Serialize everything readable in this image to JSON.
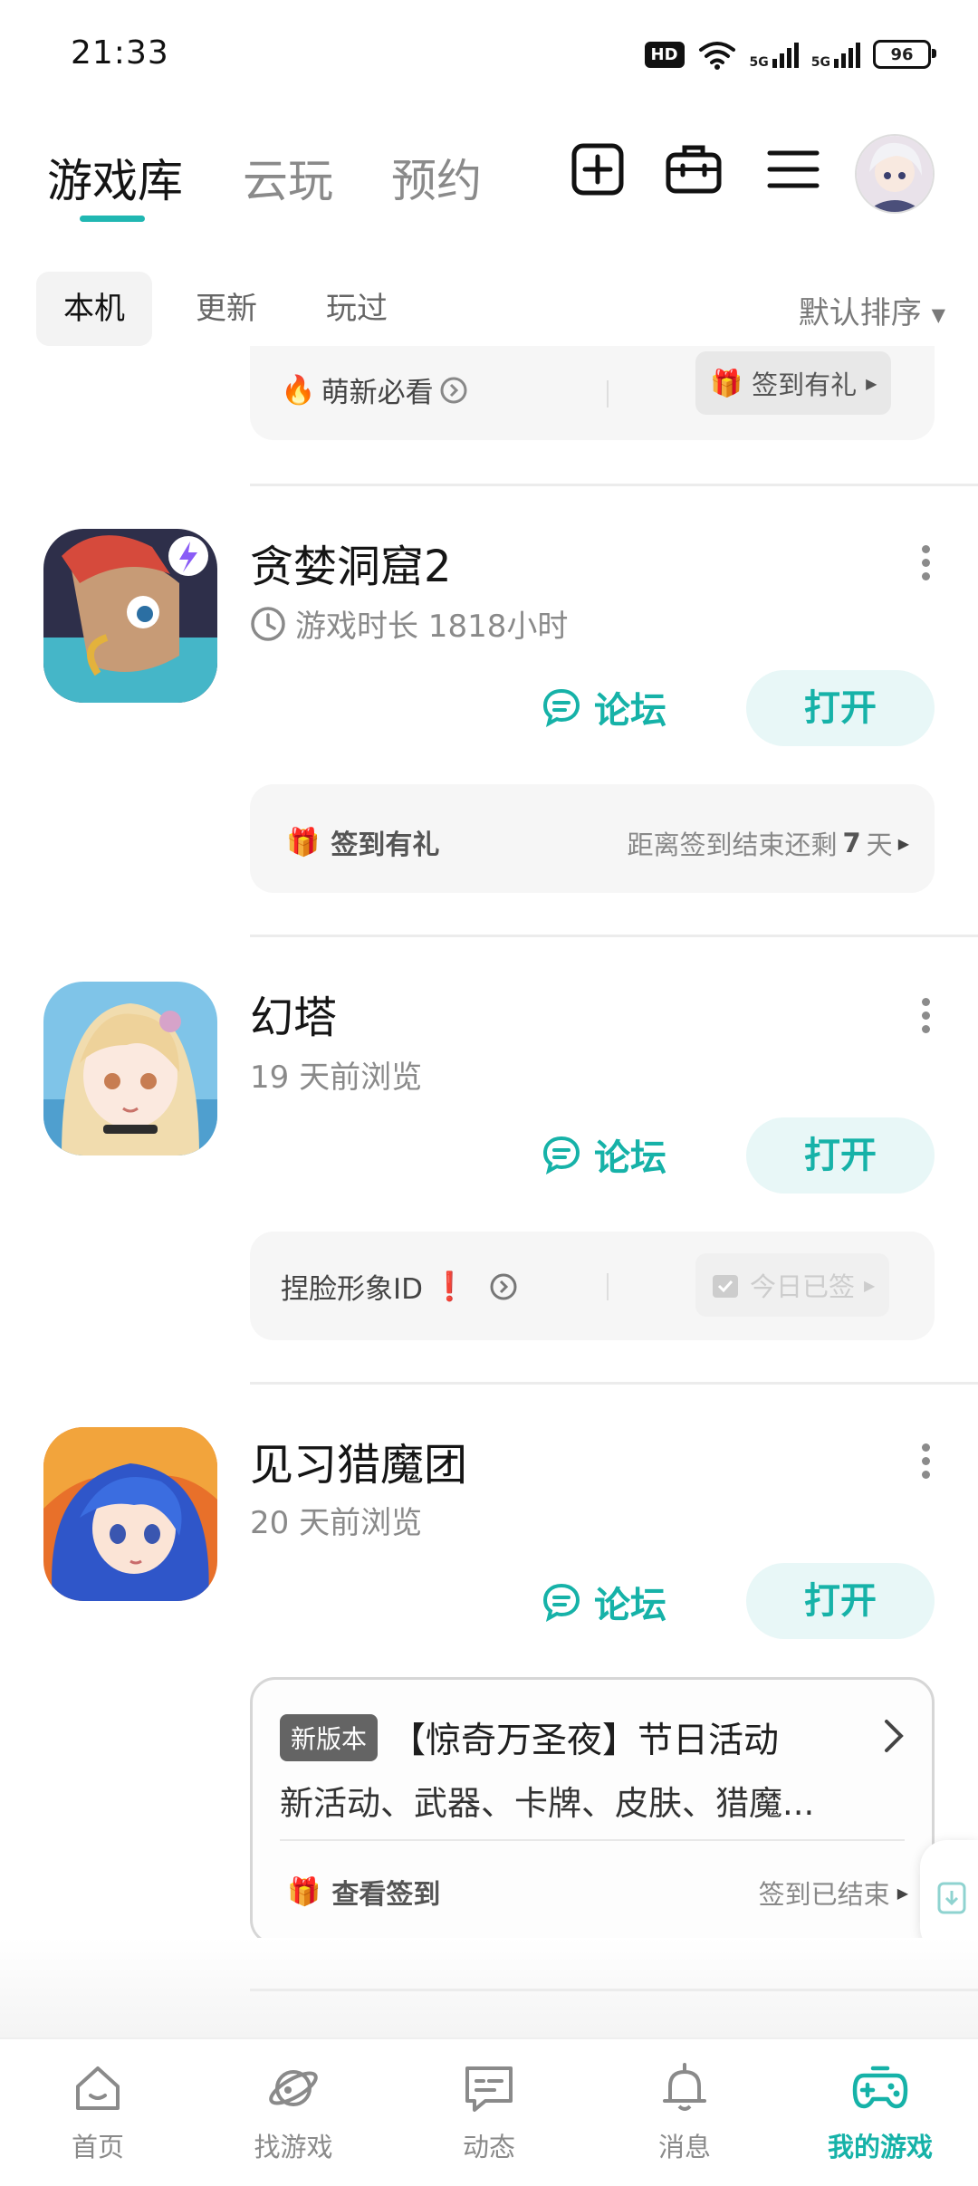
{
  "status_bar": {
    "time": "21:33",
    "hd_label": "HD",
    "net1": "5G",
    "net2": "5G",
    "battery": "96"
  },
  "header": {
    "tabs": [
      "游戏库",
      "云玩",
      "预约"
    ],
    "active_tab": 0,
    "icons": [
      "add-icon",
      "toolbox-icon",
      "menu-icon",
      "avatar"
    ]
  },
  "sub_tabs": {
    "items": [
      "本机",
      "更新",
      "玩过"
    ],
    "active": 0,
    "sort_label": "默认排序"
  },
  "partial_card": {
    "info_text": "萌新必看",
    "pill_text": "签到有礼"
  },
  "games": [
    {
      "title": "贪婪洞窟2",
      "subtitle": "游戏时长 1818小时",
      "forum_label": "论坛",
      "open_label": "打开",
      "bar_left": "签到有礼",
      "bar_right_prefix": "距离签到结束还剩",
      "bar_right_days": "7",
      "bar_right_suffix": "天"
    },
    {
      "title": "幻塔",
      "subtitle": "19 天前浏览",
      "forum_label": "论坛",
      "open_label": "打开",
      "bar_left": "捏脸形象ID",
      "bar_pill": "今日已签"
    },
    {
      "title": "见习猎魔团",
      "subtitle": "20 天前浏览",
      "forum_label": "论坛",
      "open_label": "打开",
      "news_badge": "新版本",
      "news_title": "【惊奇万圣夜】节日活动",
      "news_desc": "新活动、武器、卡牌、皮肤、猎魔...",
      "bar_left": "查看签到",
      "bar_right": "签到已结束"
    }
  ],
  "bottom_nav": {
    "items": [
      {
        "label": "首页",
        "icon": "home-icon"
      },
      {
        "label": "找游戏",
        "icon": "planet-icon"
      },
      {
        "label": "动态",
        "icon": "chat-icon"
      },
      {
        "label": "消息",
        "icon": "bell-icon"
      },
      {
        "label": "我的游戏",
        "icon": "gamepad-icon"
      }
    ],
    "active": 4
  },
  "colors": {
    "accent": "#16b2a8",
    "accent_light": "#e8f7f7",
    "text_primary": "#151515",
    "text_secondary": "#8a8a8a"
  }
}
